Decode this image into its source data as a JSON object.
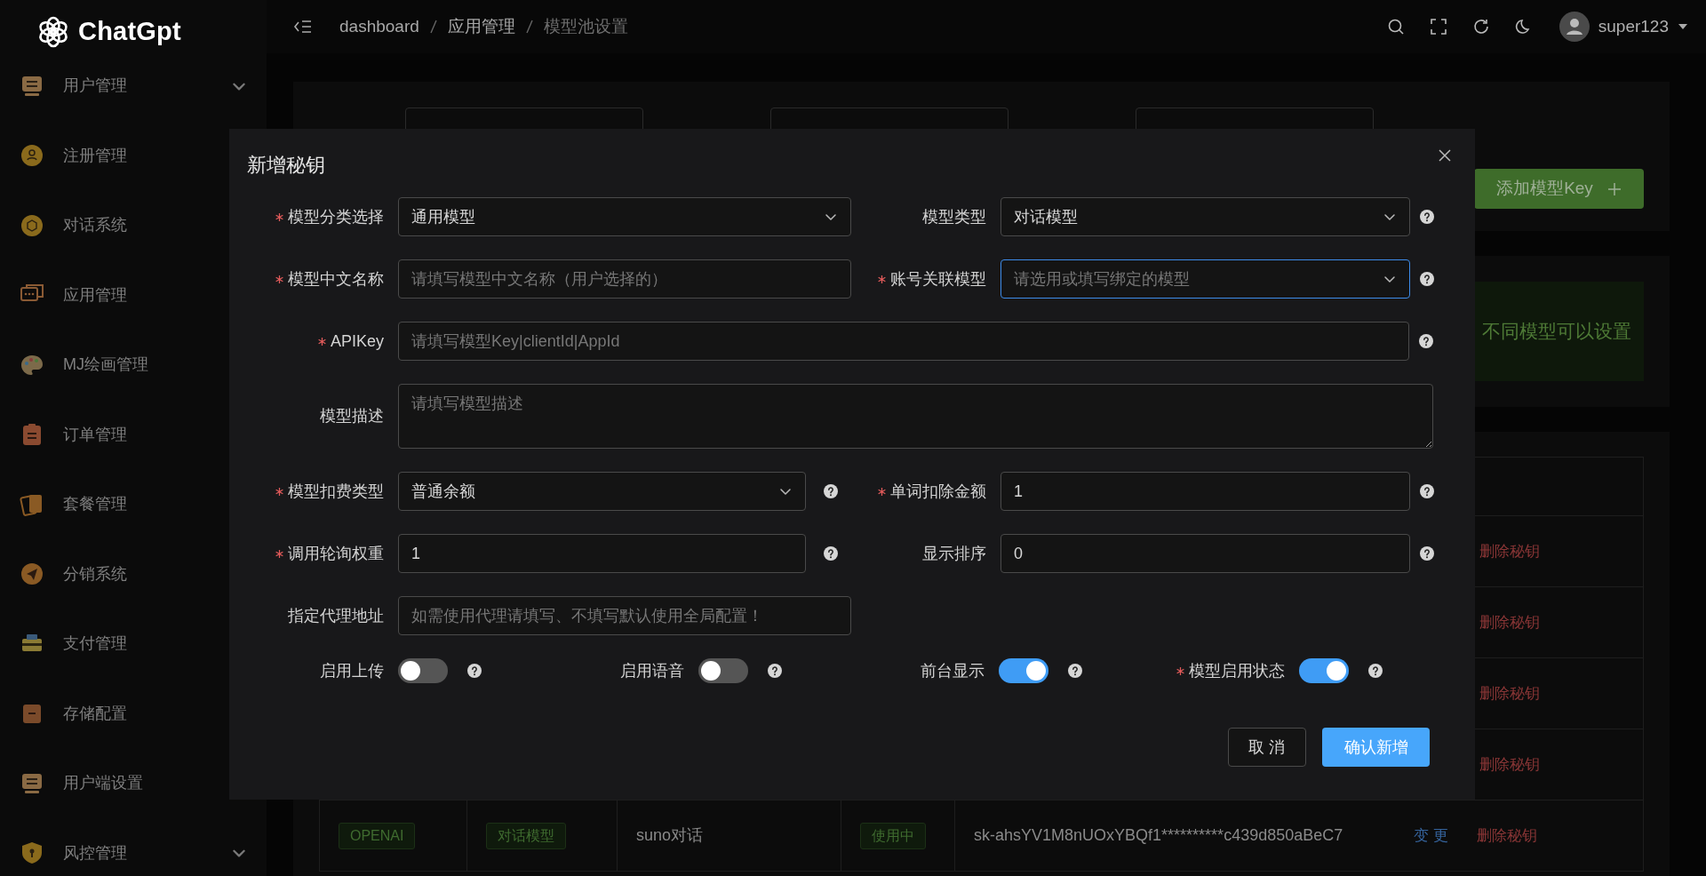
{
  "sidebar": {
    "logo": "ChatGpt",
    "items": [
      {
        "label": "用户管理",
        "has_submenu": true
      },
      {
        "label": "注册管理"
      },
      {
        "label": "对话系统"
      },
      {
        "label": "应用管理"
      },
      {
        "label": "MJ绘画管理"
      },
      {
        "label": "订单管理"
      },
      {
        "label": "套餐管理"
      },
      {
        "label": "分销系统"
      },
      {
        "label": "支付管理"
      },
      {
        "label": "存储配置"
      },
      {
        "label": "用户端设置"
      },
      {
        "label": "风控管理",
        "has_submenu": true
      }
    ]
  },
  "header": {
    "breadcrumbs": [
      "dashboard",
      "应用管理",
      "模型池设置"
    ],
    "user": "super123"
  },
  "add_button": "添加模型Key",
  "alert": "不同模型可以设置",
  "table": {
    "rows": [
      {
        "delete": "删除秘钥"
      },
      {
        "delete": "删除秘钥"
      },
      {
        "delete": "删除秘钥"
      },
      {
        "delete": "删除秘钥"
      },
      {
        "provider": "OPENAI",
        "type": "对话模型",
        "name": "suno对话",
        "status": "使用中",
        "key": "sk-ahsYV1M8nUOxYBQf1**********c439d850aBeC7",
        "change": "变 更",
        "delete": "删除秘钥"
      }
    ]
  },
  "dialog": {
    "title": "新增秘钥",
    "rows": [
      [
        {
          "kind": "select",
          "label": "模型分类选择",
          "required": true,
          "value": "通用模型",
          "help": false,
          "focused": false
        },
        {
          "kind": "select",
          "label": "模型类型",
          "required": false,
          "value": "对话模型",
          "help": true,
          "focused": false
        }
      ],
      [
        {
          "kind": "input",
          "label": "模型中文名称",
          "required": true,
          "placeholder": "请填写模型中文名称（用户选择的）",
          "help": false,
          "focused": false
        },
        {
          "kind": "select",
          "label": "账号关联模型",
          "required": true,
          "placeholder": "请选用或填写绑定的模型",
          "help": true,
          "focused": true
        }
      ],
      [
        {
          "kind": "input",
          "label": "APIKey",
          "required": true,
          "placeholder": "请填写模型Key|clientId|AppId",
          "help": true,
          "focused": false
        }
      ],
      [
        {
          "kind": "textarea",
          "label": "模型描述",
          "required": false,
          "placeholder": "请填写模型描述",
          "help": false,
          "focused": false
        }
      ],
      [
        {
          "kind": "select",
          "label": "模型扣费类型",
          "required": true,
          "value": "普通余额",
          "help": true,
          "focused": false
        },
        {
          "kind": "input",
          "label": "单词扣除金额",
          "required": true,
          "value": "1",
          "help": true,
          "focused": false
        }
      ],
      [
        {
          "kind": "input",
          "label": "调用轮询权重",
          "required": true,
          "value": "1",
          "help": true,
          "focused": false
        },
        {
          "kind": "input",
          "label": "显示排序",
          "required": false,
          "value": "0",
          "help": true,
          "focused": false
        }
      ],
      [
        {
          "kind": "input",
          "label": "指定代理地址",
          "required": false,
          "placeholder": "如需使用代理请填写、不填写默认使用全局配置！",
          "help": false,
          "focused": false
        }
      ]
    ],
    "switches": [
      {
        "label": "启用上传",
        "required": false,
        "on": false
      },
      {
        "label": "启用语音",
        "required": false,
        "on": false
      },
      {
        "label": "前台显示",
        "required": false,
        "on": true
      },
      {
        "label": "模型启用状态",
        "required": true,
        "on": true
      }
    ],
    "cancel": "取 消",
    "confirm": "确认新增"
  }
}
